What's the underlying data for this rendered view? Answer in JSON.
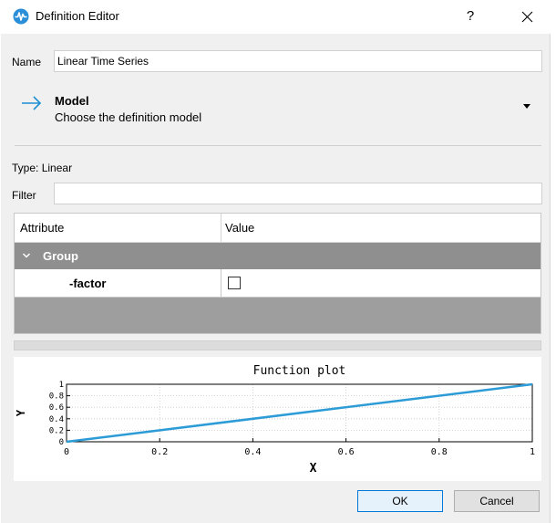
{
  "window": {
    "title": "Definition Editor",
    "help_label": "?",
    "close_icon": "close-icon",
    "app_icon": "waveform-icon",
    "accent": "#1e90d2"
  },
  "form": {
    "name_label": "Name",
    "name_value": "Linear Time Series",
    "type_label": "Type:",
    "type_value": "Linear",
    "filter_label": "Filter",
    "filter_value": ""
  },
  "model": {
    "icon": "arrow-right-icon",
    "title": "Model",
    "description": "Choose the definition model",
    "dropdown_icon": "dropdown-triangle-icon"
  },
  "table": {
    "columns": [
      "Attribute",
      "Value"
    ],
    "group_label": "Group",
    "group_icon": "chevron-down-icon",
    "rows": [
      {
        "attribute": "-factor",
        "checked": false
      }
    ]
  },
  "chart_data": {
    "type": "line",
    "title": "Function plot",
    "xlabel": "X",
    "ylabel": "Y",
    "xlim": [
      0,
      1
    ],
    "ylim": [
      0,
      1
    ],
    "x_ticks": [
      "0",
      "0.2",
      "0.4",
      "0.6",
      "0.8",
      "1"
    ],
    "y_ticks": [
      "0",
      "0.2",
      "0.4",
      "0.6",
      "0.8",
      "1"
    ],
    "grid": true,
    "series": [
      {
        "x": [
          0,
          1
        ],
        "y": [
          0,
          1
        ],
        "color": "#2c9bd6"
      }
    ]
  },
  "buttons": {
    "ok": "OK",
    "cancel": "Cancel"
  }
}
